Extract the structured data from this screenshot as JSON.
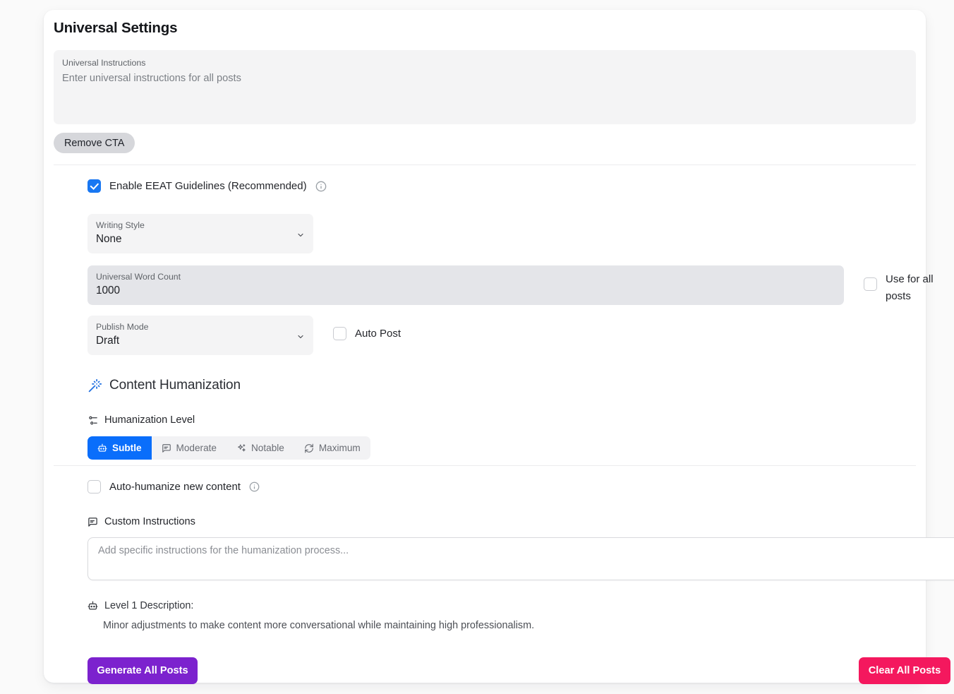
{
  "card": {
    "title": "Universal Settings"
  },
  "universal_instructions": {
    "label": "Universal Instructions",
    "placeholder": "Enter universal instructions for all posts",
    "value": ""
  },
  "remove_cta": {
    "label": "Remove CTA"
  },
  "eeat": {
    "label": "Enable EEAT Guidelines (Recommended)",
    "checked": "true",
    "info_icon": "info-circle-icon"
  },
  "writing_style": {
    "label": "Writing Style",
    "value": "None",
    "chevron_icon": "chevron-down-icon"
  },
  "word_count": {
    "label": "Universal Word Count",
    "value": "1000"
  },
  "use_for_all_posts": {
    "label": "Use for all posts",
    "checked": "false"
  },
  "publish_mode": {
    "label": "Publish Mode",
    "value": "Draft",
    "chevron_icon": "chevron-down-icon"
  },
  "auto_post": {
    "label": "Auto Post",
    "checked": "false"
  },
  "humanization": {
    "section_title": "Content Humanization",
    "section_icon": "magic-wand-icon",
    "level_title": "Humanization Level",
    "level_icon": "sliders-icon",
    "levels": [
      {
        "label": "Subtle",
        "icon": "bot-icon",
        "active": "true"
      },
      {
        "label": "Moderate",
        "icon": "message-square-icon",
        "active": "false"
      },
      {
        "label": "Notable",
        "icon": "sparkles-icon",
        "active": "false"
      },
      {
        "label": "Maximum",
        "icon": "refresh-cw-icon",
        "active": "false"
      }
    ],
    "auto_humanize": {
      "label": "Auto-humanize new content",
      "checked": "false",
      "info_icon": "info-circle-icon"
    },
    "custom_instructions": {
      "label": "Custom Instructions",
      "icon": "message-square-icon",
      "placeholder": "Add specific instructions for the humanization process...",
      "value": ""
    },
    "level_description": {
      "icon": "bot-icon",
      "title": "Level 1 Description:",
      "text": "Minor adjustments to make content more conversational while maintaining high professionalism."
    }
  },
  "footer": {
    "generate_label": "Generate All Posts",
    "clear_label": "Clear All Posts"
  },
  "colors": {
    "accent_blue": "#0a6efb",
    "checkbox_blue": "#1877f2",
    "purple": "#7c22ce",
    "pink": "#f4185e",
    "page_bg": "#fafafa",
    "card_bg": "#ffffff",
    "field_bg": "#f4f4f5",
    "wordcount_bg": "#e4e5e9"
  }
}
